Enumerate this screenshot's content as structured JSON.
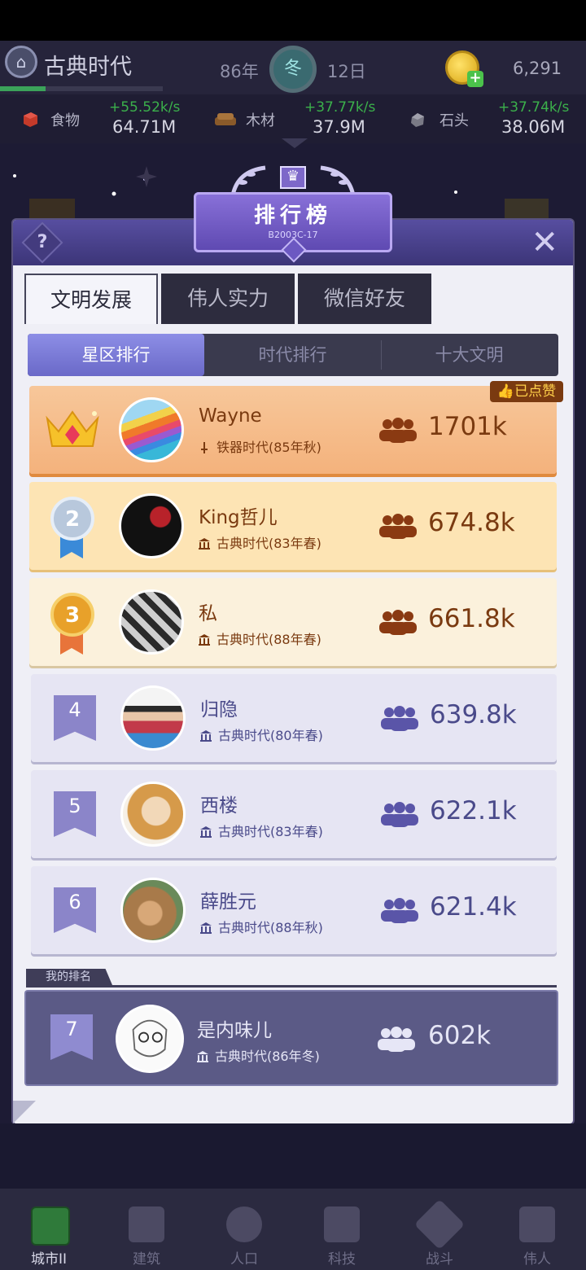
{
  "header": {
    "era_name": "古典时代",
    "year": "86年",
    "season": "冬",
    "day": "12日",
    "gold": "6,291",
    "era_progress_fraction": 0.28
  },
  "resources": [
    {
      "icon": "meat-icon",
      "name": "食物",
      "rate": "+55.52k/s",
      "amount": "64.71M"
    },
    {
      "icon": "wood-icon",
      "name": "木材",
      "rate": "+37.77k/s",
      "amount": "37.9M"
    },
    {
      "icon": "stone-icon",
      "name": "石头",
      "rate": "+37.74k/s",
      "amount": "38.06M"
    }
  ],
  "panel": {
    "title": "排行榜",
    "subtitle": "B2003C-17",
    "help_glyph": "?",
    "close_glyph": "✕",
    "tabs": [
      "文明发展",
      "伟人实力",
      "微信好友"
    ],
    "subtabs": [
      "星区排行",
      "时代排行",
      "十大文明"
    ],
    "liked_badge": "已点赞",
    "my_rank_label": "我的排名"
  },
  "rows": [
    {
      "rank": "1",
      "name": "Wayne",
      "era": "铁器时代(85年秋)",
      "score": "1701k"
    },
    {
      "rank": "2",
      "name": "King哲儿",
      "era": "古典时代(83年春)",
      "score": "674.8k"
    },
    {
      "rank": "3",
      "name": "私",
      "era": "古典时代(88年春)",
      "score": "661.8k"
    },
    {
      "rank": "4",
      "name": "归隐",
      "era": "古典时代(80年春)",
      "score": "639.8k"
    },
    {
      "rank": "5",
      "name": "西楼",
      "era": "古典时代(83年春)",
      "score": "622.1k"
    },
    {
      "rank": "6",
      "name": "薛胜元",
      "era": "古典时代(88年秋)",
      "score": "621.4k"
    }
  ],
  "my_row": {
    "rank": "7",
    "name": "是内味儿",
    "era": "古典时代(86年冬)",
    "score": "602k"
  },
  "nav": [
    "城市II",
    "建筑",
    "人口",
    "科技",
    "战斗",
    "伟人"
  ],
  "colors": {
    "panel_header": "#4a4290",
    "gold_row": "#f4b27c",
    "silver_row": "#fde4b4",
    "bronze_row": "#fbf1dc",
    "normal_row": "#e6e5f3",
    "accent_green": "#3bb04b"
  }
}
